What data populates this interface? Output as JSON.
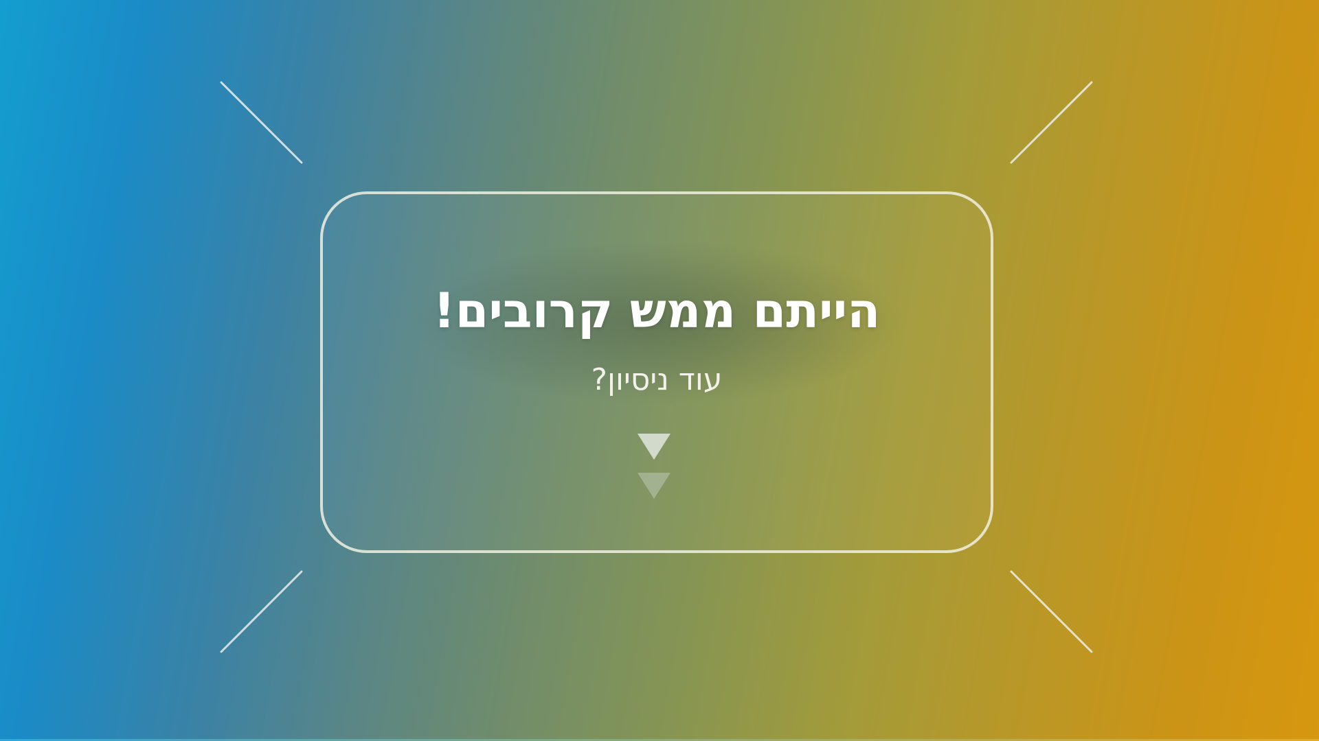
{
  "screen": {
    "title": "הייתם ממש קרובים!",
    "subtitle": "עוד ניסיון?",
    "retry_icon": "double-chevron-down-icon"
  },
  "colors": {
    "gradient_start": "#149ed0",
    "gradient_end": "#d7970f",
    "text": "#ffffff",
    "frame": "#f0f0e1"
  }
}
